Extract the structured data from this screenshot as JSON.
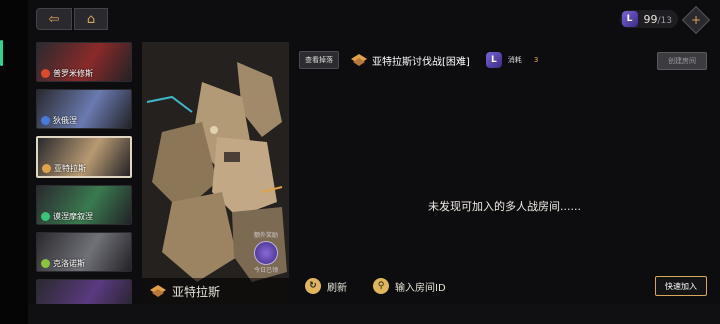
{
  "colors": {
    "accent": "#d9a85a",
    "stamina": "#7b63d6",
    "cost_num": "#e9b44a"
  },
  "nav": {
    "back_icon": "arrow-left-icon",
    "home_icon": "home-icon"
  },
  "stamina": {
    "current": "99",
    "max": "/13",
    "icon_glyph": "L"
  },
  "boss_list": [
    {
      "label": "普罗米修斯",
      "dot": "#d94b2b",
      "tint": "#8a2a2a"
    },
    {
      "label": "狄俄涅",
      "dot": "#4a7ad9",
      "tint": "#6a7ab0"
    },
    {
      "label": "亚特拉斯",
      "dot": "#e0a24a",
      "tint": "#b89a72"
    },
    {
      "label": "谟涅摩叙涅",
      "dot": "#3ac47a",
      "tint": "#3a7a50"
    },
    {
      "label": "克洛诺斯",
      "dot": "#8ac43a",
      "tint": "#707078"
    },
    {
      "label": "赫卡忒",
      "dot": "#9a5ad9",
      "tint": "#5a3a80"
    }
  ],
  "portrait": {
    "name": "亚特拉斯",
    "badge_title": "额外奖励",
    "badge_sub": "今日已领"
  },
  "header": {
    "view_drops": "查看掉落",
    "boss_title": "亚特拉斯讨伐战[困难]",
    "cost_label": "消耗",
    "cost_value": "3",
    "create_room": "创建房间"
  },
  "room": {
    "empty_message": "未发现可加入的多人战房间......"
  },
  "bottom": {
    "refresh": "刷新",
    "enter_id": "输入房间ID",
    "quick_join": "快速加入"
  }
}
